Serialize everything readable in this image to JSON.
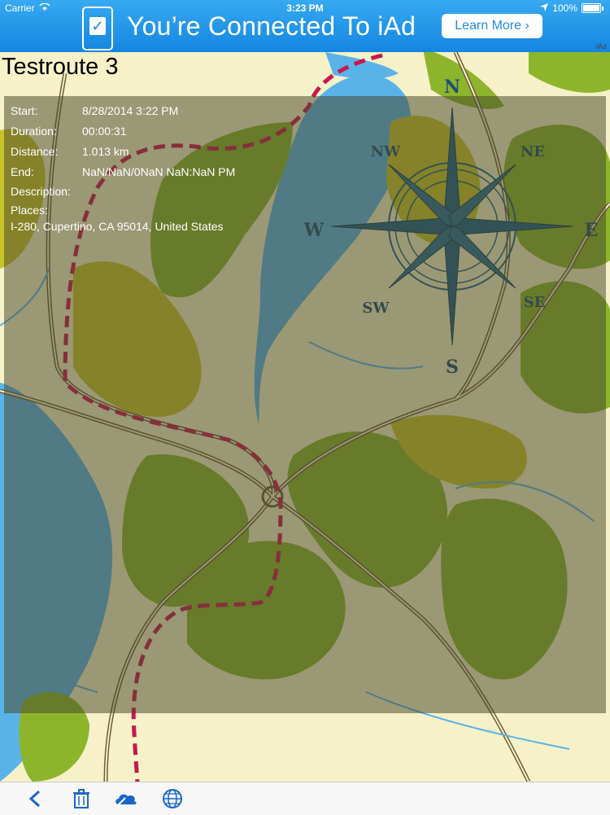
{
  "status": {
    "carrier": "Carrier",
    "time": "3:23 PM",
    "battery": "100%"
  },
  "ad": {
    "headline": "You’re Connected To iAd",
    "button": "Learn More ›",
    "tag": "iAd"
  },
  "route": {
    "title": "Testroute 3"
  },
  "details": {
    "start": {
      "label": "Start:",
      "value": "8/28/2014 3:22 PM"
    },
    "duration": {
      "label": "Duration:",
      "value": "00:00:31"
    },
    "distance": {
      "label": "Distance:",
      "value": "1.013 km"
    },
    "end": {
      "label": "End:",
      "value": "NaN/NaN/0NaN NaN:NaN PM"
    },
    "description": {
      "label": "Description:"
    },
    "places": {
      "label": "Places:",
      "value": "I-280, Cupertino, CA 95014, United States"
    }
  },
  "compass": {
    "n": "N",
    "ne": "NE",
    "e": "E",
    "se": "SE",
    "s": "S",
    "sw": "SW",
    "w": "W",
    "nw": "NW"
  },
  "toolbar": {
    "icons": [
      "back-icon",
      "trash-icon",
      "cloud-icon",
      "globe-icon"
    ]
  },
  "colors": {
    "accent": "#1a66c8",
    "route": "#c8174f",
    "water": "#5ab3e8",
    "land": "#f6f1c8",
    "forest": "#8db52c"
  }
}
